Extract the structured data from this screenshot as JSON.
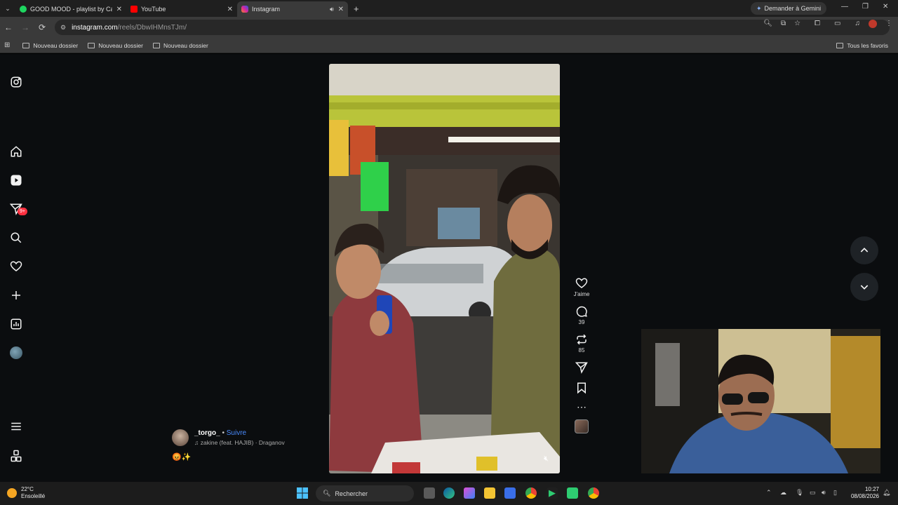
{
  "browser": {
    "tabs": [
      {
        "title": "GOOD MOOD - playlist by Cas",
        "favicon_color": "#1ed760"
      },
      {
        "title": "YouTube",
        "favicon_color": "#ff0000"
      },
      {
        "title": "Instagram",
        "favicon_color": "#d6249f"
      }
    ],
    "gemini_label": "Demander à Gemini",
    "url_host": "instagram.com",
    "url_path": "/reels/DbwIHMnsTJm/",
    "bookmarks": [
      "Nouveau dossier",
      "Nouveau dossier",
      "Nouveau dossier"
    ],
    "all_favorites": "Tous les favoris"
  },
  "sidebar": {
    "notification_badge": "9+",
    "icons": [
      "instagram-logo-icon",
      "home-icon",
      "reels-icon",
      "messages-icon",
      "search-icon",
      "heart-icon",
      "plus-icon",
      "dashboard-icon",
      "profile-avatar",
      "menu-icon",
      "apps-icon"
    ]
  },
  "reel": {
    "like_label": "J'aime",
    "comments_count": "39",
    "reposts_count": "85",
    "username": "_torgo_",
    "separator": "•",
    "follow_label": "Suivre",
    "audio": "zakine (feat. HAJIB) · Draganov",
    "caption_emojis": "😡✨"
  },
  "taskbar": {
    "temperature": "22°C",
    "weather": "Ensoleillé",
    "search_placeholder": "Rechercher",
    "time": "10:27",
    "date": "08/08/2026"
  },
  "colors": {
    "accent_blue": "#4a8cff",
    "badge_red": "#ff3040"
  }
}
